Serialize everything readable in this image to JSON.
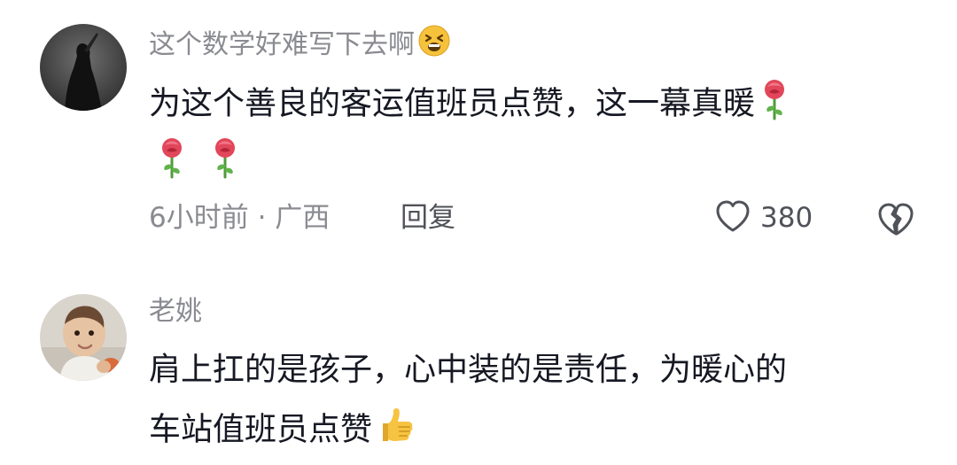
{
  "comments": [
    {
      "username": "这个数学好难写下去啊",
      "username_emoji": "tired-face-emoji",
      "text_line1": "为这个善良的客运值班员点赞，这一幕真暖",
      "text_line2_emojis": [
        "rose-emoji",
        "rose-emoji",
        "rose-emoji"
      ],
      "meta": "6小时前 · 广西",
      "reply_label": "回复",
      "like_count": "380",
      "icons": {
        "like": "heart-outline-icon",
        "dislike": "broken-heart-icon"
      }
    },
    {
      "username": "老姚",
      "text_line1": "肩上扛的是孩子，心中装的是责任，为暖心的",
      "text_line2": "车站值班员点赞",
      "text_line2_emoji": "thumbs-up-emoji"
    }
  ],
  "colors": {
    "primary_text": "#161823",
    "secondary_text": "#8a8b91",
    "action_text": "#505259",
    "background": "#ffffff"
  }
}
